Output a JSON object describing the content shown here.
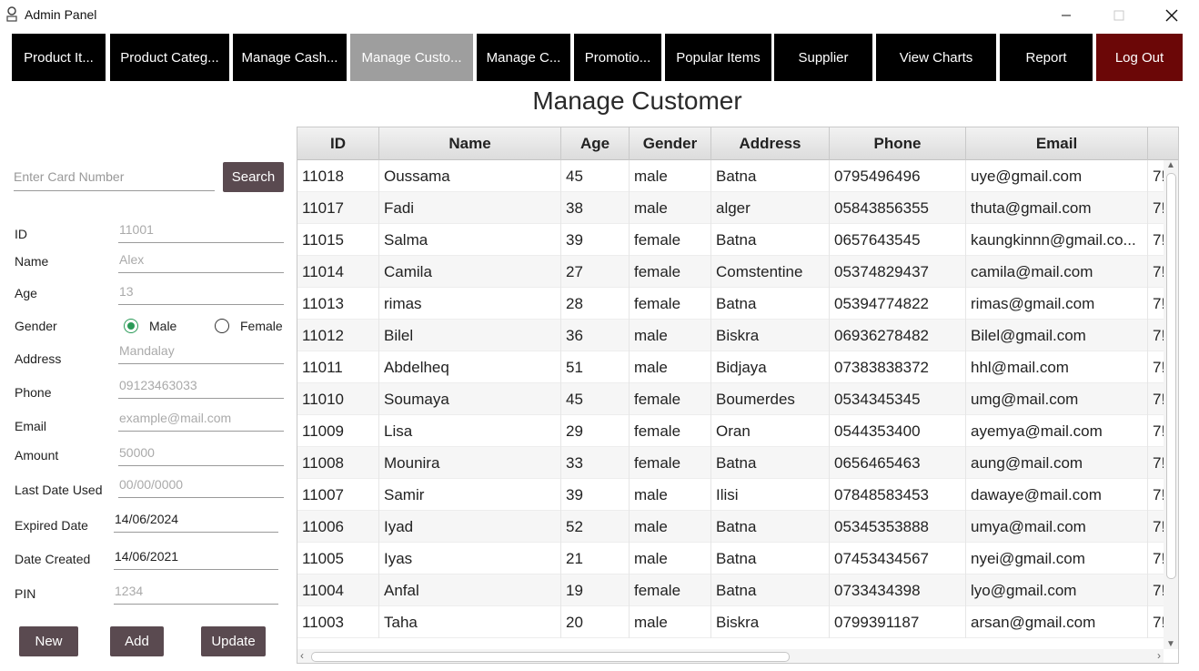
{
  "window": {
    "title": "Admin Panel"
  },
  "nav": [
    {
      "label": "Product It...",
      "state": "normal"
    },
    {
      "label": "Product Categ...",
      "state": "normal"
    },
    {
      "label": "Manage Cash...",
      "state": "normal"
    },
    {
      "label": "Manage Custo...",
      "state": "active"
    },
    {
      "label": "Manage C...",
      "state": "normal"
    },
    {
      "label": "Promotio...",
      "state": "normal"
    },
    {
      "label": "Popular Items",
      "state": "normal"
    },
    {
      "label": "Supplier",
      "state": "normal"
    },
    {
      "label": "View Charts",
      "state": "normal"
    },
    {
      "label": "Report",
      "state": "normal"
    },
    {
      "label": "Log Out",
      "state": "logout"
    }
  ],
  "page": {
    "title": "Manage Customer"
  },
  "search": {
    "placeholder": "Enter Card Number",
    "button": "Search"
  },
  "form": {
    "id": {
      "label": "ID",
      "placeholder": "11001"
    },
    "name": {
      "label": "Name",
      "placeholder": "Alex"
    },
    "age": {
      "label": "Age",
      "placeholder": "13"
    },
    "gender": {
      "label": "Gender",
      "male": "Male",
      "female": "Female",
      "selected": "Male"
    },
    "address": {
      "label": "Address",
      "placeholder": "Mandalay"
    },
    "phone": {
      "label": "Phone",
      "placeholder": "09123463033"
    },
    "email": {
      "label": "Email",
      "placeholder": "example@mail.com"
    },
    "amount": {
      "label": "Amount",
      "placeholder": "50000"
    },
    "last_date_used": {
      "label": "Last Date Used",
      "placeholder": "00/00/0000"
    },
    "expired_date": {
      "label": "Expired Date",
      "value": "14/06/2024"
    },
    "date_created": {
      "label": "Date Created",
      "value": "14/06/2021"
    },
    "pin": {
      "label": "PIN",
      "placeholder": "1234"
    }
  },
  "buttons": {
    "new": "New",
    "add": "Add",
    "update": "Update"
  },
  "table": {
    "columns": [
      "ID",
      "Name",
      "Age",
      "Gender",
      "Address",
      "Phone",
      "Email"
    ],
    "rows": [
      [
        "11018",
        "Oussama",
        "45",
        "male",
        "Batna",
        "0795496496",
        "uye@gmail.com",
        "7!"
      ],
      [
        "11017",
        "Fadi",
        "38",
        "male",
        "alger",
        "05843856355",
        "thuta@gmail.com",
        "7!"
      ],
      [
        "11015",
        "Salma",
        "39",
        "female",
        "Batna",
        "0657643545",
        "kaungkinnn@gmail.co...",
        "7!"
      ],
      [
        "11014",
        "Camila",
        "27",
        "female",
        "Comstentine",
        "05374829437",
        "camila@mail.com",
        "7!"
      ],
      [
        "11013",
        "rimas",
        "28",
        "female",
        "Batna",
        "05394774822",
        "rimas@gmail.com",
        "7!"
      ],
      [
        "11012",
        "Bilel",
        "36",
        "male",
        "Biskra",
        "06936278482",
        "Bilel@gmail.com",
        "7!"
      ],
      [
        "11011",
        "Abdelheq",
        "51",
        "male",
        "Bidjaya",
        "07383838372",
        "hhl@mail.com",
        "7!"
      ],
      [
        "11010",
        "Soumaya",
        "45",
        "female",
        "Boumerdes",
        "0534345345",
        "umg@mail.com",
        "7!"
      ],
      [
        "11009",
        "Lisa",
        "29",
        "female",
        "Oran",
        "0544353400",
        "ayemya@mail.com",
        "7!"
      ],
      [
        "11008",
        "Mounira",
        "33",
        "female",
        "Batna",
        "0656465463",
        "aung@mail.com",
        "7!"
      ],
      [
        "11007",
        "Samir",
        "39",
        "male",
        "Ilisi",
        "07848583453",
        "dawaye@mail.com",
        "7!"
      ],
      [
        "11006",
        "Iyad",
        "52",
        "male",
        "Batna",
        "05345353888",
        "umya@mail.com",
        "7!"
      ],
      [
        "11005",
        "Iyas",
        "21",
        "male",
        "Batna",
        "07453434567",
        "nyei@gmail.com",
        "7!"
      ],
      [
        "11004",
        "Anfal",
        "19",
        "female",
        "Batna",
        "0733434398",
        "lyo@gmail.com",
        "7!"
      ],
      [
        "11003",
        "Taha",
        "20",
        "male",
        "Biskra",
        "0799391187",
        "arsan@gmail.com",
        "7!"
      ]
    ]
  },
  "icons": {
    "app": "app-logo-icon",
    "minimize": "minimize-icon",
    "maximize": "maximize-icon",
    "close": "close-icon"
  },
  "colors": {
    "nav_bg": "#000000",
    "nav_active": "#9e9e9e",
    "logout": "#6b0707",
    "form_button": "#5a4a50",
    "radio_selected": "#2a9a57"
  }
}
